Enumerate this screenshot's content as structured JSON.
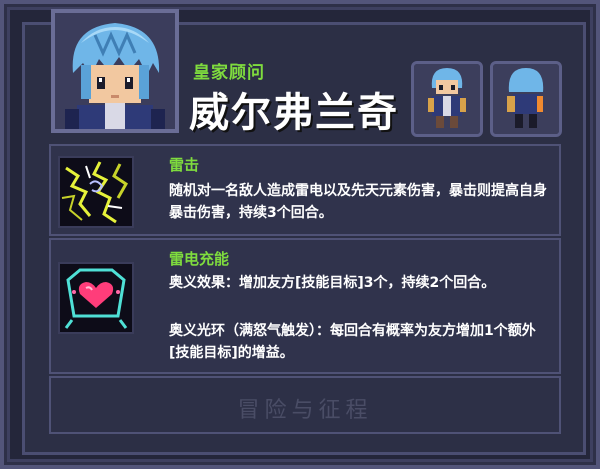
{
  "hero": {
    "title": "皇家顾问",
    "name": "威尔弗兰奇"
  },
  "skills": [
    {
      "name": "雷击",
      "description": "随机对一名敌人造成雷电以及先天元素伤害，暴击则提高自身暴击伤害，持续3个回合。",
      "icon": "lightning-strike-icon"
    },
    {
      "name": "雷电充能",
      "description_1": "奥义效果：增加友方[技能目标]3个，持续2个回合。",
      "description_2": "奥义光环（满怒气触发）：每回合有概率为友方增加1个额外[技能目标]的增益。",
      "icon": "lightning-charge-heart-icon"
    }
  ],
  "watermark": "冒险与征程",
  "colors": {
    "accent_green": "#7fdc3e",
    "panel": "#2c2f45",
    "border": "#53557a"
  }
}
